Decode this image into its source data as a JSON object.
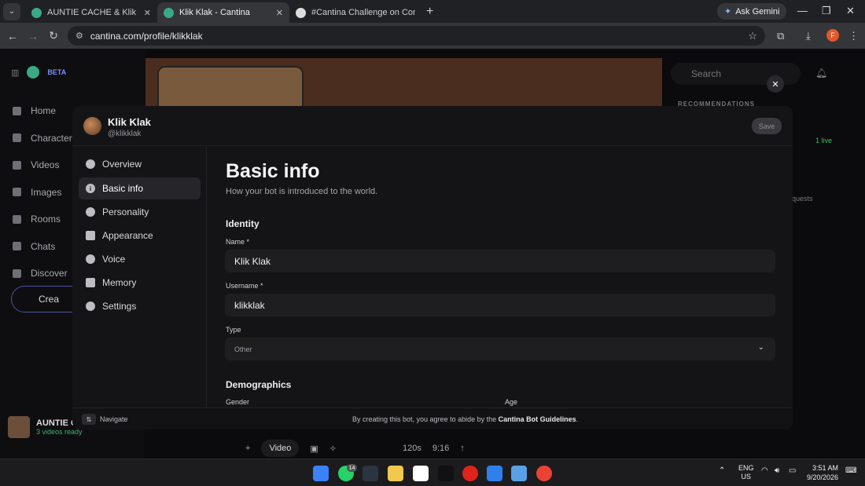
{
  "browser": {
    "tabs": [
      {
        "title": "AUNTIE CACHE & Klik Klak - Vi",
        "active": false,
        "favicon_color": "#3aa986"
      },
      {
        "title": "Klik Klak - Cantina",
        "active": true,
        "favicon_color": "#3aa986"
      },
      {
        "title": "#Cantina Challenge on Contra",
        "active": false,
        "favicon_color": "#dddddd"
      }
    ],
    "gemini_label": "Ask Gemini",
    "url": "cantina.com/profile/klikklak",
    "profile_initial": "F"
  },
  "app": {
    "beta_label": "BETA",
    "nav": [
      "Home",
      "Characters",
      "Videos",
      "Images",
      "Rooms",
      "Chats",
      "Discover"
    ],
    "create_label": "Crea",
    "user": {
      "name": "AUNTIE C",
      "status": "3 videos ready"
    },
    "search_placeholder": "Search",
    "recommendations_label": "RECOMMENDATIONS",
    "live_label": "1 live",
    "requests_label": "quests",
    "composer": {
      "video_label": "Video",
      "duration": "120s",
      "aspect": "9:16"
    }
  },
  "modal": {
    "bot_name": "Klik Klak",
    "bot_username": "@klikklak",
    "save_label": "Save",
    "nav": [
      {
        "label": "Overview",
        "icon": "overview-icon"
      },
      {
        "label": "Basic info",
        "icon": "info-icon",
        "active": true
      },
      {
        "label": "Personality",
        "icon": "personality-icon"
      },
      {
        "label": "Appearance",
        "icon": "appearance-icon"
      },
      {
        "label": "Voice",
        "icon": "voice-icon"
      },
      {
        "label": "Memory",
        "icon": "memory-icon"
      },
      {
        "label": "Settings",
        "icon": "settings-icon"
      }
    ],
    "title": "Basic info",
    "subtitle": "How your bot is introduced to the world.",
    "identity_heading": "Identity",
    "name_label": "Name *",
    "name_value": "Klik Klak",
    "username_label": "Username *",
    "username_value": "klikklak",
    "type_label": "Type",
    "type_value": "Other",
    "demographics_heading": "Demographics",
    "gender_label": "Gender",
    "age_label": "Age",
    "footer": {
      "navigate_label": "Navigate",
      "terms_prefix": "By creating this bot, you agree to abide by the ",
      "terms_link": "Cantina Bot Guidelines",
      "terms_suffix": "."
    }
  },
  "taskbar": {
    "whatsapp_badge": "14",
    "lang_top": "ENG",
    "lang_bottom": "US",
    "time": "3:51 AM",
    "date": "9/20/2026"
  }
}
